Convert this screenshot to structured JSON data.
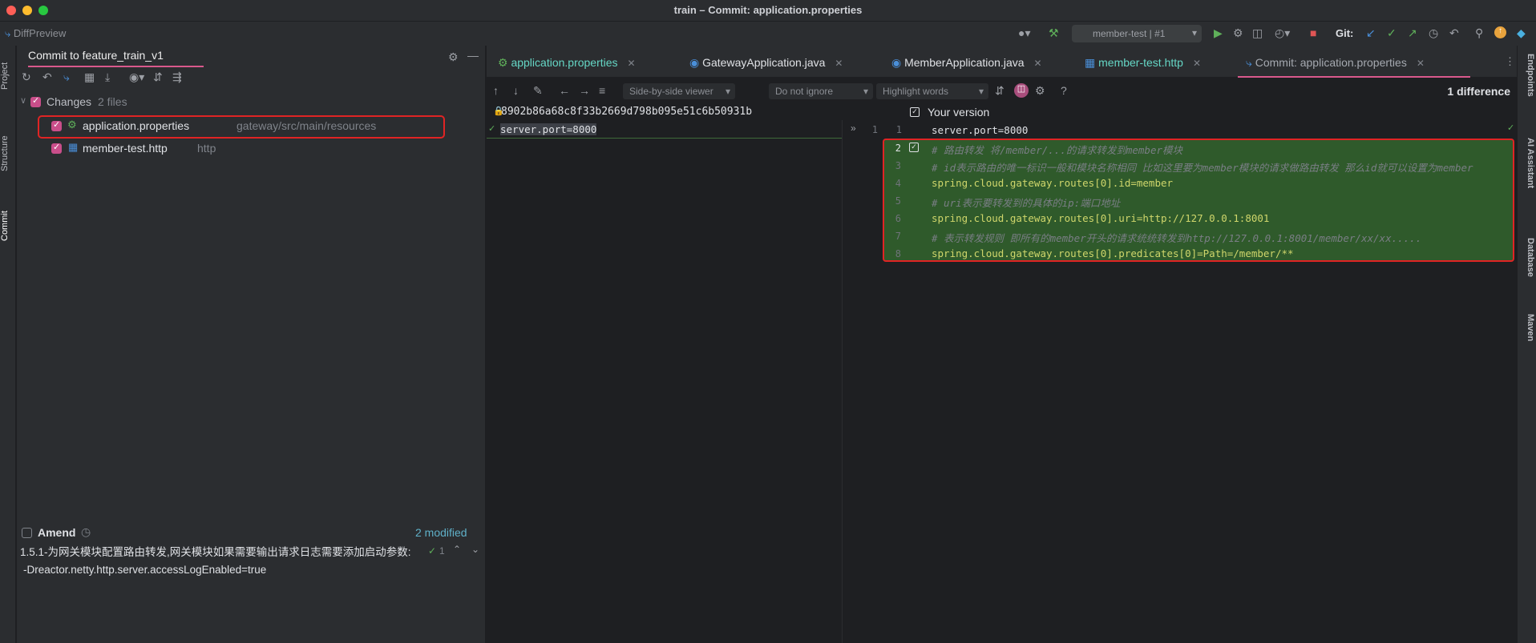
{
  "window": {
    "title": "train – Commit: application.properties"
  },
  "toolbar": {
    "diff_preview": "DiffPreview",
    "run_config": "member-test | #1",
    "git_label": "Git:"
  },
  "left_tabs": {
    "project": "Project",
    "structure": "Structure",
    "commit": "Commit"
  },
  "right_tabs": {
    "endpoints": "Endpoints",
    "ai": "AI Assistant",
    "database": "Database",
    "maven": "Maven"
  },
  "commit_panel": {
    "tab_title": "Commit to feature_train_v1",
    "changes_label": "Changes",
    "changes_count": "2 files",
    "files": [
      {
        "name": "application.properties",
        "path": "gateway/src/main/resources"
      },
      {
        "name": "member-test.http",
        "path": "http"
      }
    ],
    "amend_label": "Amend",
    "modified_count": "2 modified",
    "message_line1": "1.5.1-为网关模块配置路由转发,网关模块如果需要输出请求日志需要添加启动参数:",
    "message_line2": "-Dreactor.netty.http.server.accessLogEnabled=true",
    "check_count": "1"
  },
  "editor_tabs": [
    {
      "label": "application.properties"
    },
    {
      "label": "GatewayApplication.java"
    },
    {
      "label": "MemberApplication.java"
    },
    {
      "label": "member-test.http"
    },
    {
      "label": "Commit: application.properties"
    }
  ],
  "diff_toolbar": {
    "viewer": "Side-by-side viewer",
    "ignore": "Do not ignore",
    "highlight": "Highlight words",
    "difference_count": "1 difference"
  },
  "diff": {
    "left_header": "8902b86a68c8f33b2669d798b095e51c6b50931b",
    "right_header": "Your version",
    "left_lines": [
      {
        "n": "1",
        "text": "server.port=8000"
      }
    ],
    "right_lines": [
      {
        "n": "1",
        "text": "server.port=8000"
      },
      {
        "n": "2",
        "text": "# 路由转发 将/member/...的请求转发到member模块"
      },
      {
        "n": "3",
        "text": "# id表示路由的唯一标识一般和模块名称相同 比如这里要为member模块的请求做路由转发 那么id就可以设置为member"
      },
      {
        "n": "4",
        "text": "spring.cloud.gateway.routes[0].id=member"
      },
      {
        "n": "5",
        "text": "# uri表示要转发到的具体的ip:端口地址"
      },
      {
        "n": "6",
        "text": "spring.cloud.gateway.routes[0].uri=http://127.0.0.1:8001"
      },
      {
        "n": "7",
        "text": "# 表示转发规则 即所有的member开头的请求统统转发到http://127.0.0.1:8001/member/xx/xx....."
      },
      {
        "n": "8",
        "text": "spring.cloud.gateway.routes[0].predicates[0]=Path=/member/**"
      }
    ]
  },
  "colors": {
    "accent": "#d9598c",
    "added_bg": "#2f5a2b",
    "highlight_border": "#e02424"
  }
}
